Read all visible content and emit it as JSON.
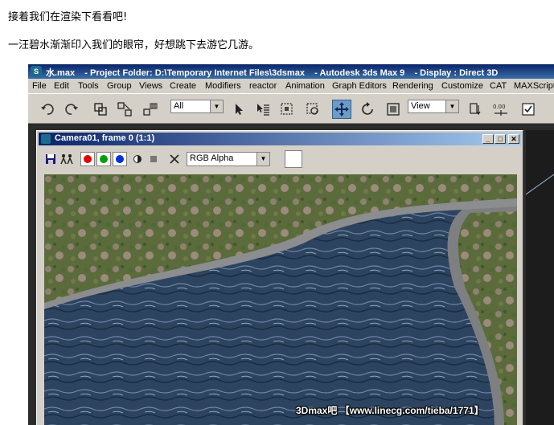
{
  "captions": {
    "line1": "接着我们在渲染下看看吧!",
    "line2": "一汪碧水渐渐印入我们的眼帘，好想跳下去游它几游。"
  },
  "app": {
    "title": "水.max    - Project Folder: D:\\Temporary Internet Files\\3dsmax    - Autodesk 3ds Max 9    - Display : Direct 3D",
    "menu": [
      "File",
      "Edit",
      "Tools",
      "Group",
      "Views",
      "Create",
      "Modifiers",
      "reactor",
      "Animation",
      "Graph Editors",
      "Rendering",
      "Customize",
      "CAT",
      "MAXScript"
    ],
    "toolbar": {
      "selection_filter": "All",
      "reference_coord": "View",
      "icons": [
        "undo-icon",
        "redo-icon",
        "select-and-link-icon",
        "unlink-icon",
        "bind-space-warp-icon",
        "select-object-icon",
        "select-by-name-icon",
        "rectangular-selection-icon",
        "window-crossing-icon",
        "select-and-move-icon",
        "select-and-rotate-icon",
        "select-and-scale-icon",
        "pivot-center-icon",
        "snap-toggle-icon",
        "named-selection-icon"
      ],
      "spinner_label": "0.00"
    }
  },
  "framebuffer": {
    "title": "Camera01, frame 0 (1:1)",
    "channel": "RGB Alpha",
    "buttons": [
      "save-icon",
      "clone-icon",
      "red-channel",
      "green-channel",
      "blue-channel",
      "alpha-channel",
      "mono-channel",
      "clear-icon"
    ],
    "colors": {
      "red": "#e00000",
      "green": "#00a000",
      "blue": "#0030e0"
    }
  },
  "watermark": "3Dmax吧 【www.linecg.com/tieba/1771】"
}
